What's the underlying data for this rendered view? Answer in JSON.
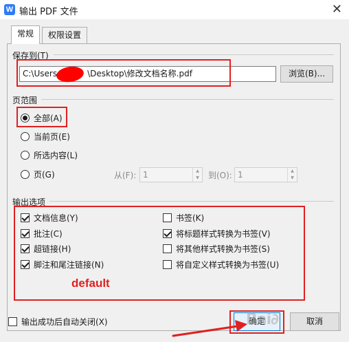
{
  "window": {
    "title": "输出 PDF 文件",
    "app_icon": "W"
  },
  "tabs": [
    {
      "label": "常规",
      "active": true
    },
    {
      "label": "权限设置",
      "active": false
    }
  ],
  "save_to": {
    "group_label": "保存到(T)",
    "path_value": "C:\\Users\\\\Desktop\\修改文档名称.pdf",
    "path_prefix": "C:\\Users",
    "path_suffix": "\\Desktop\\修改文档名称.pdf",
    "browse_label": "浏览(B)..."
  },
  "page_range": {
    "group_label": "页范围",
    "options": [
      {
        "label": "全部(A)",
        "checked": true
      },
      {
        "label": "当前页(E)",
        "checked": false
      },
      {
        "label": "所选内容(L)",
        "checked": false
      },
      {
        "label": "页(G)",
        "checked": false
      }
    ],
    "from_label": "从(F):",
    "from_value": "1",
    "to_label": "到(O):",
    "to_value": "1"
  },
  "output_options": {
    "group_label": "输出选项",
    "left": [
      {
        "label": "文档信息(Y)",
        "checked": true
      },
      {
        "label": "批注(C)",
        "checked": true
      },
      {
        "label": "超链接(H)",
        "checked": true
      },
      {
        "label": "脚注和尾注链接(N)",
        "checked": true
      }
    ],
    "right": [
      {
        "label": "书签(K)",
        "checked": false
      },
      {
        "label": "将标题样式转换为书签(V)",
        "checked": true
      },
      {
        "label": "将其他样式转换为书签(S)",
        "checked": false
      },
      {
        "label": "将自定义样式转换为书签(U)",
        "checked": false
      }
    ]
  },
  "annotation_text": "default",
  "footer": {
    "auto_close_label": "输出成功后自动关闭(X)",
    "auto_close_checked": false,
    "ok_label": "确定",
    "cancel_label": "取消"
  },
  "colors": {
    "annotation_red": "#e02020",
    "accent_blue": "#2f7cf6"
  }
}
